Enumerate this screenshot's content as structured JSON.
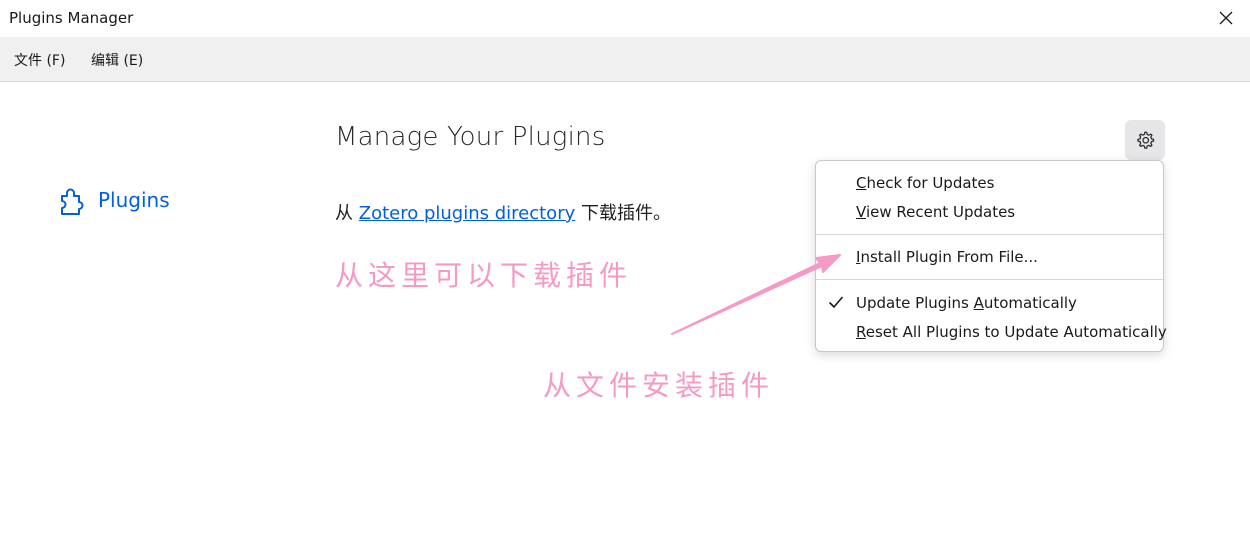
{
  "window": {
    "title": "Plugins Manager"
  },
  "menu": {
    "file": "文件 (F)",
    "edit": "编辑 (E)"
  },
  "sidebar": {
    "items": [
      {
        "label": "Plugins",
        "icon": "puzzle-piece-icon"
      }
    ]
  },
  "main": {
    "heading": "Manage Your Plugins",
    "desc_prefix": "从 ",
    "desc_link": "Zotero plugins directory",
    "desc_suffix": " 下载插件。"
  },
  "gear_menu": {
    "icon": "gear-icon",
    "items": [
      {
        "label": "Check for Updates",
        "mnemonic": "C"
      },
      {
        "label": "View Recent Updates",
        "mnemonic": "V"
      },
      {
        "label": "Install Plugin From File...",
        "mnemonic": "I"
      },
      {
        "label": "Update Plugins Automatically",
        "mnemonic": "A",
        "checked": true
      },
      {
        "label": "Reset All Plugins to Update Automatically",
        "mnemonic": "R"
      }
    ]
  },
  "annotations": {
    "download_here": "从这里可以下载插件",
    "install_from_file": "从文件安装插件",
    "color": "#f49ac5"
  },
  "colors": {
    "link": "#0061e0",
    "menubar": "#f0f0f0"
  }
}
